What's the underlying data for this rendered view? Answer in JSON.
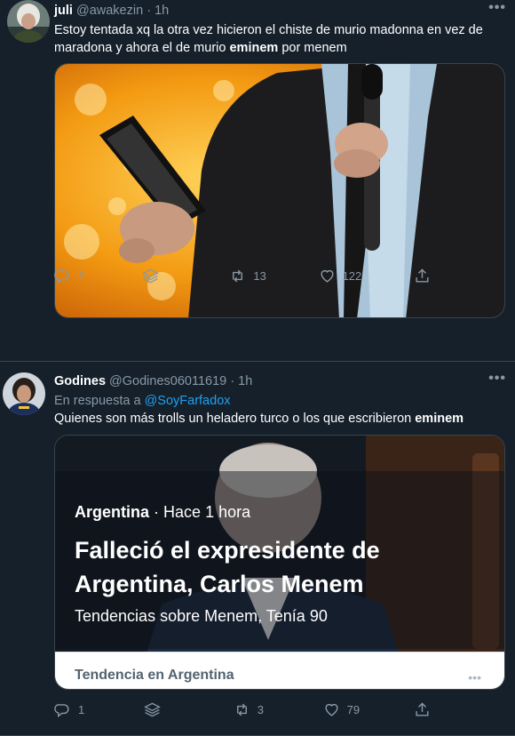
{
  "tweet1": {
    "name": "juli",
    "handle": "@awakezin",
    "dot": "·",
    "time": "1h",
    "more": "•••",
    "text_pre": "Estoy tentada xq la otra vez hicieron el chiste de murio madonna en vez de maradona y ahora el de murio ",
    "text_bold": "eminem",
    "text_post": " por menem",
    "actions": {
      "replies": "2",
      "retweets": "13",
      "likes": "122"
    }
  },
  "tweet2": {
    "name": "Godines",
    "handle": "@Godines06011619",
    "dot": "·",
    "time": "1h",
    "more": "•••",
    "reply_prefix": "En respuesta a",
    "reply_to": "@SoyFarfadox",
    "text_pre": "Quienes son más trolls un heladero turco o los que escribieron ",
    "text_bold": "eminem",
    "card": {
      "source": "Argentina",
      "dot": "·",
      "time": "Hace 1 hora",
      "headline": "Falleció el expresidente de Argentina, Carlos Menem",
      "sub": "Tendencias sobre Menem, Tenía 90",
      "footer": "Tendencia en Argentina",
      "footer_more": "•••"
    },
    "actions": {
      "replies": "1",
      "retweets": "3",
      "likes": "79"
    }
  },
  "colors": {
    "background": "#15202b",
    "muted": "#8899a6",
    "link": "#1da1f2",
    "border": "#38444d"
  },
  "icons": [
    "reply-icon",
    "layers-icon",
    "retweet-icon",
    "like-icon",
    "share-icon",
    "more-icon"
  ]
}
